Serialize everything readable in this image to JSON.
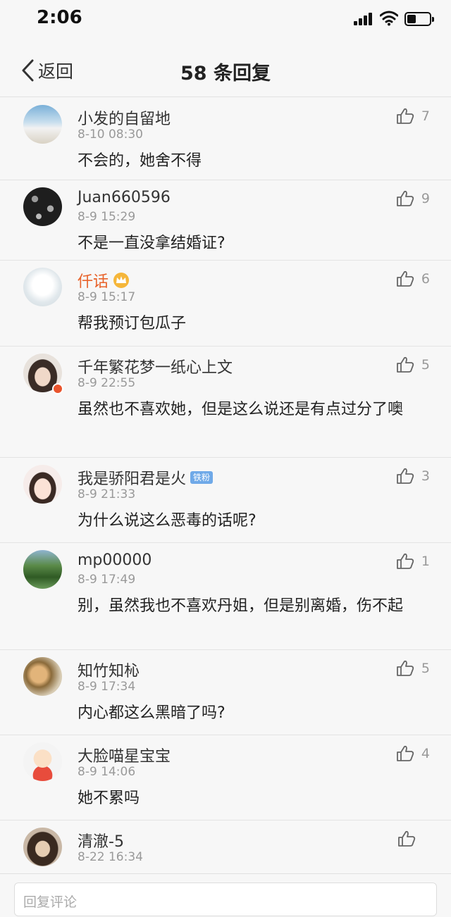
{
  "status_bar": {
    "time": "2:06"
  },
  "nav": {
    "back_label": "返回",
    "title": "58 条回复"
  },
  "comments": [
    {
      "username": "小发的自留地",
      "time": "8-10 08:30",
      "text": "不会的，她舍不得",
      "likes": "7",
      "avatar_colors": [
        "#9ec6e0",
        "#dfe8ee"
      ]
    },
    {
      "username": "Juan660596",
      "time": "8-9 15:29",
      "text": "不是一直没拿结婚证?",
      "likes": "9",
      "avatar_colors": [
        "#222222",
        "#888888"
      ]
    },
    {
      "username": "仟话",
      "time": "8-9 15:17",
      "text": "帮我预订包瓜子",
      "likes": "6",
      "avatar_colors": [
        "#dfe6ea",
        "#f4f4f4"
      ]
    },
    {
      "username": "千年繁花梦一纸心上文",
      "time": "8-9 22:55",
      "text": "虽然也不喜欢她，但是这么说还是有点过分了噢",
      "likes": "5",
      "avatar_colors": [
        "#c7b6aa",
        "#efe4dc"
      ]
    },
    {
      "username": "我是骄阳君是火",
      "time": "8-9 21:33",
      "text": "为什么说这么恶毒的话呢?",
      "likes": "3",
      "badge": "铁粉",
      "avatar_colors": [
        "#f0d0cc",
        "#faf0ee"
      ]
    },
    {
      "username": "mp00000",
      "time": "8-9 17:49",
      "text": "别，虽然我也不喜欢丹姐，但是别离婚，伤不起",
      "likes": "1",
      "avatar_colors": [
        "#4c7a3a",
        "#9fc0d8"
      ]
    },
    {
      "username": "知竹知杺",
      "time": "8-9 17:34",
      "text": "内心都这么黑暗了吗?",
      "likes": "5",
      "avatar_colors": [
        "#c8a062",
        "#e8dcc4"
      ]
    },
    {
      "username": "大脸喵星宝宝",
      "time": "8-9 14:06",
      "text": "她不累吗",
      "likes": "4",
      "avatar_colors": [
        "#f2c7a0",
        "#e84c3c"
      ]
    },
    {
      "username": "清澈-5",
      "time": "8-22 16:34",
      "text": "",
      "likes": "",
      "avatar_colors": [
        "#5a4a3c",
        "#d8c0a8"
      ]
    }
  ],
  "reply_bar": {
    "placeholder": "回复评论"
  },
  "icons": {
    "back": "chevron-left-icon",
    "like": "thumbs-up-icon",
    "crown": "crown-icon"
  },
  "colors": {
    "vip_name": "#e8632b",
    "fan_badge": "#6fa9e8"
  }
}
